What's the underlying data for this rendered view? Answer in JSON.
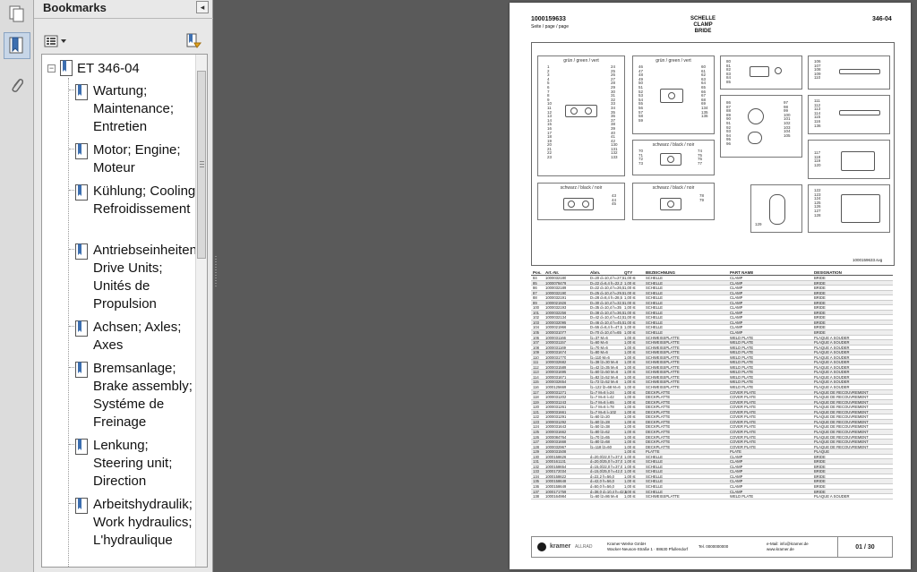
{
  "sidebar": {
    "title": "Bookmarks",
    "collapse_glyph": "◂",
    "tools": [
      {
        "icon": "pages-icon"
      },
      {
        "icon": "bookmark-icon",
        "active": true
      },
      {
        "icon": "paperclip-icon"
      }
    ],
    "options_icon": "options-menu-icon",
    "action_icon": "bookmark-action-icon"
  },
  "bookmarks": {
    "root_expander": "−",
    "root": "ET 346-04",
    "items": [
      {
        "label": "Wartung; Maintenance; Entretien"
      },
      {
        "label": "Motor; Engine; Moteur"
      },
      {
        "label": "Kühlung; Cooling; Refroidissement"
      },
      {
        "label": "Antriebseinheiten; Drive Units; Unités de Propulsion"
      },
      {
        "label": "Achsen; Axles; Axes"
      },
      {
        "label": "Bremsanlage; Brake assembly; Systéme de Freinage"
      },
      {
        "label": "Lenkung; Steering unit; Direction"
      },
      {
        "label": "Arbeitshydraulik; Work hydraulics; L'hydraulique"
      }
    ]
  },
  "document": {
    "part_no": "1000159633",
    "page_caption": "Seite / page / page",
    "title_de": "SCHELLE",
    "title_en": "CLAMP",
    "title_fr": "BRIDE",
    "doc_code": "346-04",
    "diagram_ref": "1000159633.svg",
    "diagram_labels": {
      "green": "grün / green / vert",
      "black": "schwarz / black / noir"
    },
    "diagram_numbers": {
      "b1_left": "1\n2\n3\n4\n5\n6\n7\n8\n9\n10\n11\n12\n13\n14\n15\n16\n17\n18\n19\n20\n21\n22\n23",
      "b1_right": "24\n25\n26\n27\n28\n29\n30\n31\n32\n33\n34\n35\n36\n37\n38\n39\n40\n41\n42\n130\n131\n132\n133",
      "b2_left": "46\n47\n48\n49\n50\n51\n52\n53\n54\n55\n56\n57\n58\n59",
      "b2_right": "60\n61\n62\n63\n64\n65\n66\n67\n68\n69\n134\n135\n136",
      "b3": "80\n81\n82\n83\n84\n85",
      "b4": "106\n107\n108\n109\n110",
      "b5_left": "86\n87\n88\n89\n90\n91\n92\n93\n94\n95\n96",
      "b5_right": "97\n98\n99\n100\n101\n102\n103\n104\n105",
      "b6_left": "70\n71\n72\n73",
      "b6_right": "74\n75\n76\n77",
      "b7": "111\n112\n113\n114\n115\n116\n136",
      "b8": "117\n118\n119\n120",
      "b9": "43\n44\n45",
      "b10": "78\n79",
      "b11": "129",
      "b12": "122\n123\n124\n125\n126\n127\n128"
    },
    "table": {
      "headers": [
        "Pos.",
        "Art.-Nr.",
        "Abm.",
        "QTY",
        "BEZEICHNUNG",
        "PART NAME",
        "DESIGNATION"
      ],
      "rows": [
        [
          "84",
          "1000032180",
          "D=20 d=10,4 h=27,5",
          "1,00 st",
          "SCHELLE",
          "CLAMP",
          "BRIDE"
        ],
        [
          "85",
          "1000078479",
          "D=22 d=6,4 h=22,2",
          "1,00 st",
          "SCHELLE",
          "CLAMP",
          "BRIDE"
        ],
        [
          "86",
          "1000032189",
          "D=22 d=10,4 h=26,5",
          "1,00 st",
          "SCHELLE",
          "CLAMP",
          "BRIDE"
        ],
        [
          "87",
          "1000032190",
          "D=25 d=10,4 h=29,5",
          "1,00 st",
          "SCHELLE",
          "CLAMP",
          "BRIDE"
        ],
        [
          "88",
          "1000032191",
          "D=28 d=8,4 h=28,5",
          "1,00 st",
          "SCHELLE",
          "CLAMP",
          "BRIDE"
        ],
        [
          "89",
          "1000021926",
          "D=30 d=10,4 h=32,5",
          "1,00 st",
          "SCHELLE",
          "CLAMP",
          "BRIDE"
        ],
        [
          "100",
          "1000032193",
          "D=35 d=10,4 h=35",
          "1,00 st",
          "SCHELLE",
          "CLAMP",
          "BRIDE"
        ],
        [
          "101",
          "1000032256",
          "D=38 d=10,4 h=36,5",
          "1,00 st",
          "SCHELLE",
          "CLAMP",
          "BRIDE"
        ],
        [
          "102",
          "1000032134",
          "D=42 d=10,4 h=42,5",
          "1,00 st",
          "SCHELLE",
          "CLAMP",
          "BRIDE"
        ],
        [
          "103",
          "1000032095",
          "D=46 d=10,4 h=45,5",
          "1,00 st",
          "SCHELLE",
          "CLAMP",
          "BRIDE"
        ],
        [
          "104",
          "1000021966",
          "D=55 d=8,4 h=47,5",
          "1,00 st",
          "SCHELLE",
          "CLAMP",
          "BRIDE"
        ],
        [
          "105",
          "1000031077",
          "D=70 d=10,4 h=65",
          "1,00 st",
          "SCHELLE",
          "CLAMP",
          "BRIDE"
        ],
        [
          "106",
          "1000031166",
          "l1=37 M=6",
          "1,00 st",
          "SCHWEISSPLATTE",
          "WELD PLATE",
          "PLAQUE A SOUDER"
        ],
        [
          "107",
          "1000031157",
          "l1=60 M=6",
          "1,00 st",
          "SCHWEISSPLATTE",
          "WELD PLATE",
          "PLAQUE A SOUDER"
        ],
        [
          "108",
          "1000031169",
          "l1=70 M=6",
          "1,00 st",
          "SCHWEISSPLATTE",
          "WELD PLATE",
          "PLAQUE A SOUDER"
        ],
        [
          "109",
          "1000031674",
          "l1=80 M=6",
          "1,00 st",
          "SCHWEISSPLATTE",
          "WELD PLATE",
          "PLAQUE A SOUDER"
        ],
        [
          "110",
          "1000031770",
          "l1=110 M=6",
          "1,00 st",
          "SCHWEISSPLATTE",
          "WELD PLATE",
          "PLAQUE A SOUDER"
        ],
        [
          "111",
          "1000032682",
          "l1=38 l2=30 M=6",
          "1,00 st",
          "SCHWEISSPLATTE",
          "WELD PLATE",
          "PLAQUE A SOUDER"
        ],
        [
          "112",
          "1000031589",
          "l1=42 l2=35 M=6",
          "1,00 st",
          "SCHWEISSPLATTE",
          "WELD PLATE",
          "PLAQUE A SOUDER"
        ],
        [
          "113",
          "1000031695",
          "l1=60 l2=50 M=6",
          "1,00 st",
          "SCHWEISSPLATTE",
          "WELD PLATE",
          "PLAQUE A SOUDER"
        ],
        [
          "114",
          "1000031671",
          "l1=82 l2=52 M=6",
          "1,00 st",
          "SCHWEISSPLATTE",
          "WELD PLATE",
          "PLAQUE A SOUDER"
        ],
        [
          "115",
          "1000032654",
          "l1=72 l2=52 M=6",
          "1,00 st",
          "SCHWEISSPLATTE",
          "WELD PLATE",
          "PLAQUE A SOUDER"
        ],
        [
          "116",
          "1000125669",
          "l1=122 l2=68 M=6",
          "1,00 st",
          "SCHWEISSPLATTE",
          "WELD PLATE",
          "PLAQUE A SOUDER"
        ],
        [
          "117",
          "1000031271",
          "l1=7 M=6 l=24",
          "1,00 st",
          "DECKPLATTE",
          "COVER PLATE",
          "PLAQUE DE RECOUVREMENT"
        ],
        [
          "118",
          "1000031202",
          "l1=7 M=6 l=42",
          "1,00 st",
          "DECKPLATTE",
          "COVER PLATE",
          "PLAQUE DE RECOUVREMENT"
        ],
        [
          "119",
          "1000031243",
          "l1=7 M=6 l=65",
          "1,00 st",
          "DECKPLATTE",
          "COVER PLATE",
          "PLAQUE DE RECOUVREMENT"
        ],
        [
          "120",
          "1000031261",
          "l1=7 M=6 l=78",
          "1,00 st",
          "DECKPLATTE",
          "COVER PLATE",
          "PLAQUE DE RECOUVREMENT"
        ],
        [
          "121",
          "1000031661",
          "l1=7 M=6 l=102",
          "1,00 st",
          "DECKPLATTE",
          "COVER PLATE",
          "PLAQUE DE RECOUVREMENT"
        ],
        [
          "122",
          "1000031291",
          "l1=60 l2=20",
          "1,00 st",
          "DECKPLATTE",
          "COVER PLATE",
          "PLAQUE DE RECOUVREMENT"
        ],
        [
          "123",
          "1000031292",
          "l1=60 l2=28",
          "1,00 st",
          "DECKPLATTE",
          "COVER PLATE",
          "PLAQUE DE RECOUVREMENT"
        ],
        [
          "124",
          "1000031643",
          "l1=50 l2=38",
          "1,00 st",
          "DECKPLATTE",
          "COVER PLATE",
          "PLAQUE DE RECOUVREMENT"
        ],
        [
          "125",
          "1000031662",
          "l1=80 l2=62",
          "1,00 st",
          "DECKPLATTE",
          "COVER PLATE",
          "PLAQUE DE RECOUVREMENT"
        ],
        [
          "126",
          "1000084764",
          "l1=70 l2=65",
          "1,00 st",
          "DECKPLATTE",
          "COVER PLATE",
          "PLAQUE DE RECOUVREMENT"
        ],
        [
          "127",
          "1000031668",
          "l1=80 l2=68",
          "1,00 st",
          "DECKPLATTE",
          "COVER PLATE",
          "PLAQUE DE RECOUVREMENT"
        ],
        [
          "128",
          "1000032967",
          "l1=118 l2=60",
          "1,00 st",
          "DECKPLATTE",
          "COVER PLATE",
          "PLAQUE DE RECOUVREMENT"
        ],
        [
          "129",
          "1000031508",
          "",
          "1,00 st",
          "PLATTE",
          "PLATE",
          "PLAQUE"
        ],
        [
          "130",
          "1000158626",
          "d=20,0/22,0 h=37,0",
          "1,00 st",
          "SCHELLE",
          "CLAMP",
          "BRIDE"
        ],
        [
          "131",
          "1000161131",
          "d=20,0/25,0 h=37,0",
          "1,00 st",
          "SCHELLE",
          "CLAMP",
          "BRIDE"
        ],
        [
          "132",
          "1000158654",
          "d=15,0/22,0 h=37,0",
          "1,00 st",
          "SCHELLE",
          "CLAMP",
          "BRIDE"
        ],
        [
          "133",
          "1000172034",
          "d=15,0/25,0 h=42,0",
          "1,00 st",
          "SCHELLE",
          "CLAMP",
          "BRIDE"
        ],
        [
          "134",
          "1000158622",
          "d=22,2 h=56,0",
          "1,00 st",
          "SCHELLE",
          "CLAMP",
          "BRIDE"
        ],
        [
          "135",
          "1000158648",
          "d=42,0 h=56,0",
          "1,00 st",
          "SCHELLE",
          "CLAMP",
          "BRIDE"
        ],
        [
          "136",
          "1000158649",
          "d=50,0 h=56,0",
          "1,00 st",
          "SCHELLE",
          "CLAMP",
          "BRIDE"
        ],
        [
          "137",
          "1000171759",
          "d=38,0 d=10,4 h=42,5",
          "1,00 st",
          "SCHELLE",
          "CLAMP",
          "BRIDE"
        ],
        [
          "138",
          "1000164984",
          "l1=60 l2=86 M=6",
          "1,00 st",
          "SCHWEISSPLATTE",
          "WELD PLATE",
          "PLAQUE A SOUDER"
        ]
      ]
    },
    "footer": {
      "brand": "kramer",
      "brand_suffix": "ALLRAD",
      "company": "Kramer-Werke GmbH",
      "address": "Wacker-Neuson-Straße 1 · 88630 Pfullendorf",
      "phone": "Tel. 0000000000",
      "email": "e-Mail: info@kramer.de",
      "web": "www.kramer.de",
      "page": "01 / 30"
    }
  }
}
